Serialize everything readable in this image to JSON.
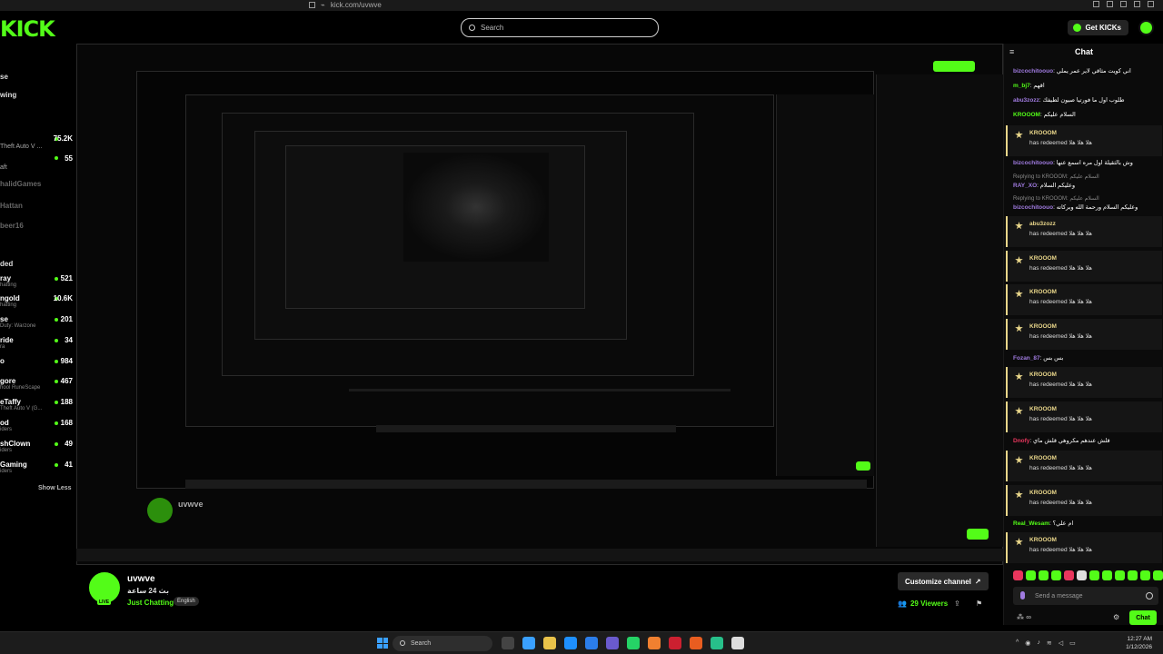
{
  "browser": {
    "url": "kick.com/uvwve"
  },
  "header": {
    "logo": "KICK",
    "search_placeholder": "Search",
    "get_kicks_label": "Get KICKs"
  },
  "sidebar": {
    "nav": [
      "se",
      "wing"
    ],
    "following": [
      {
        "name": "",
        "sub": "",
        "count": "75.2K"
      },
      {
        "name": "Theft Auto V ...",
        "sub": "",
        "count": "55"
      },
      {
        "name": "aft",
        "sub": "",
        "count": ""
      },
      {
        "name": "halidGames",
        "sub": "",
        "count": "",
        "offline": true
      },
      {
        "name": "Hattan",
        "sub": "",
        "count": "",
        "offline": true
      },
      {
        "name": "beer16",
        "sub": "",
        "count": "",
        "offline": true
      }
    ],
    "section_label": "ded",
    "recommended": [
      {
        "name": "ray",
        "sub": "hatting",
        "count": "521"
      },
      {
        "name": "ngold",
        "sub": "hatting",
        "count": "10.6K"
      },
      {
        "name": "se",
        "sub": "Duty: Warzone",
        "count": "201"
      },
      {
        "name": "ride",
        "sub": "ra",
        "count": "34"
      },
      {
        "name": "o",
        "sub": "",
        "count": "984"
      },
      {
        "name": "gore",
        "sub": "hool RuneScape",
        "count": "467"
      },
      {
        "name": "eTaffy",
        "sub": "Theft Auto V (G...",
        "count": "188"
      },
      {
        "name": "od",
        "sub": "iders",
        "count": "168"
      },
      {
        "name": "shClown",
        "sub": "iders",
        "count": "49"
      },
      {
        "name": "Gaming",
        "sub": "iders",
        "count": "41"
      }
    ],
    "show_less": "Show Less"
  },
  "channel": {
    "name": "uvwve",
    "subtitle": "بث 24 ساعة",
    "category": "Just Chatting",
    "language": "English",
    "customize_label": "Customize channel",
    "viewers": "29 Viewers",
    "live_badge": "LIVE"
  },
  "chat": {
    "title": "Chat",
    "messages": [
      {
        "user": "bizcochitoouo",
        "color": "#a07be0",
        "text": ": اني كويت مثاقي لاير عمر يملي"
      },
      {
        "user": "m_bj7",
        "color": "#53fc18",
        "text": ": اقهم"
      },
      {
        "user": "abu3zozz",
        "color": "#a07be0",
        "text": ": طلوب اول ما فورتيا صيون لطيفك"
      },
      {
        "user": "KROOOM",
        "color": "#53fc18",
        "text": ": السلام عليكم"
      }
    ],
    "redeem_1": {
      "user": "KROOOM",
      "text": "has redeemed هلا هلا هلا"
    },
    "messages_2": [
      {
        "user": "bizcochitoouo",
        "color": "#a07be0",
        "text": ": وش بالثقيلة اول مره اسمع عنها"
      }
    ],
    "reply_1": "Replying to KROOOM: السلام عليكم",
    "msg_ray": {
      "user": "RAY_XO",
      "color": "#a07be0",
      "text": ": وعليكم السلام"
    },
    "reply_2": "Replying to KROOOM: السلام عليكم",
    "msg_biz3": {
      "user": "bizcochitoouo",
      "color": "#a07be0",
      "text": ": وعليكم السلام ورحمة الله وبركاته"
    },
    "redeems": [
      {
        "user": "abu3zozz",
        "text": "has redeemed هلا هلا هلا"
      },
      {
        "user": "KROOOM",
        "text": "has redeemed هلا هلا هلا"
      },
      {
        "user": "KROOOM",
        "text": "has redeemed هلا هلا هلا"
      },
      {
        "user": "KROOOM",
        "text": "has redeemed هلا هلا هلا"
      }
    ],
    "msg_fozan": {
      "user": "Fozan_87",
      "color": "#a07be0",
      "text": ": بس بس"
    },
    "redeems_2": [
      {
        "user": "KROOOM",
        "text": "has redeemed هلا هلا هلا"
      },
      {
        "user": "KROOOM",
        "text": "has redeemed هلا هلا هلا"
      }
    ],
    "msg_dnofy": {
      "user": "Dnofy",
      "color": "#e8365d",
      "text": ": قلش عندهم مكروهي قلش ماي"
    },
    "redeems_3": [
      {
        "user": "KROOOM",
        "text": "has redeemed هلا هلا هلا"
      },
      {
        "user": "KROOOM",
        "text": "has redeemed هلا هلا هلا"
      }
    ],
    "msg_real": {
      "user": "Real_Wesam",
      "color": "#53fc18",
      "text": ": ام علي؟"
    },
    "redeem_last": {
      "user": "KROOOM",
      "text": "has redeemed هلا هلا هلا"
    },
    "send_placeholder": "Send a message",
    "chat_button": "Chat"
  },
  "taskbar": {
    "search_placeholder": "Search",
    "time": "12:27 AM",
    "date": "1/12/2026"
  }
}
